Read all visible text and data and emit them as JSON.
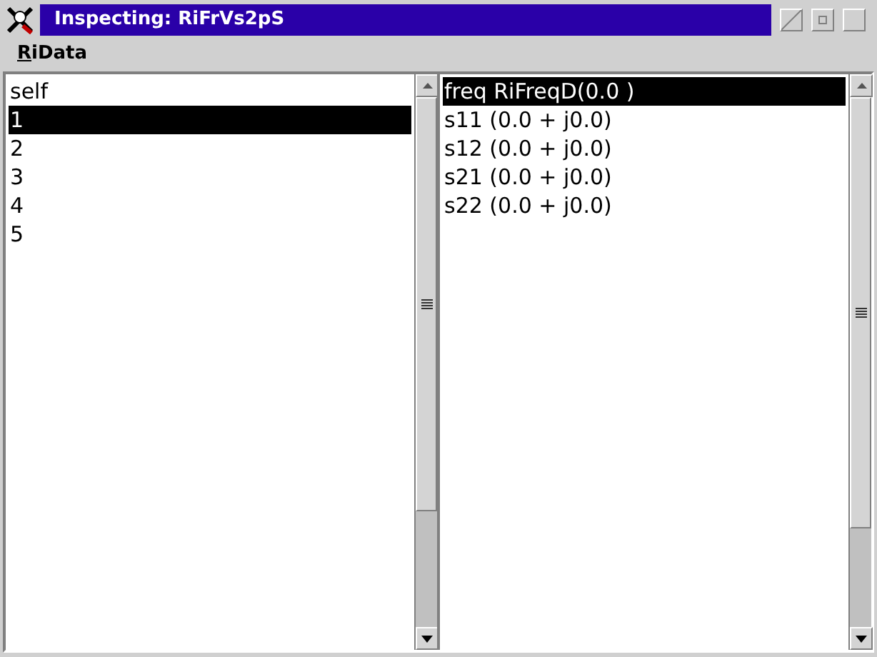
{
  "window": {
    "title": "Inspecting: RiFrVs2pS"
  },
  "menu": [
    {
      "label": "RiData"
    }
  ],
  "fields_list": [
    {
      "label": "self",
      "selected": false
    },
    {
      "label": "1",
      "selected": true
    },
    {
      "label": "2",
      "selected": false
    },
    {
      "label": "3",
      "selected": false
    },
    {
      "label": "4",
      "selected": false
    },
    {
      "label": "5",
      "selected": false
    }
  ],
  "value_list": [
    {
      "label": "freq RiFreqD(0.0 )",
      "selected": true
    },
    {
      "label": "s11 (0.0 + j0.0)",
      "selected": false
    },
    {
      "label": "s12 (0.0 + j0.0)",
      "selected": false
    },
    {
      "label": "s21 (0.0 + j0.0)",
      "selected": false
    },
    {
      "label": "s22 (0.0 + j0.0)",
      "selected": false
    }
  ]
}
